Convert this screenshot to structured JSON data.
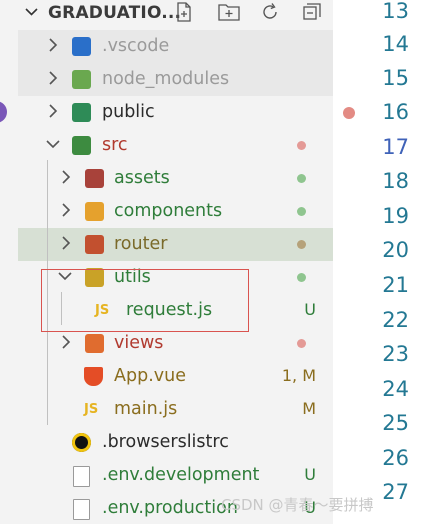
{
  "explorer": {
    "title": "GRADUATIO...",
    "actions": [
      "new-file-icon",
      "new-folder-icon",
      "refresh-icon",
      "collapse-all-icon"
    ],
    "items": [
      {
        "label": ".vscode",
        "kind": "folder",
        "expanded": false,
        "icon": "vscode-folder-icon",
        "color": "#9a9a9a",
        "depth": 0
      },
      {
        "label": "node_modules",
        "kind": "folder",
        "expanded": false,
        "icon": "node-folder-icon",
        "color": "#9a9a9a",
        "depth": 0
      },
      {
        "label": "public",
        "kind": "folder",
        "expanded": false,
        "icon": "public-folder-icon",
        "color": "#2b2b2b",
        "depth": 0
      },
      {
        "label": "src",
        "kind": "folder",
        "expanded": true,
        "icon": "src-folder-icon",
        "color": "#b13a2f",
        "status_dot": "#e49a96",
        "depth": 0
      },
      {
        "label": "assets",
        "kind": "folder",
        "expanded": false,
        "icon": "assets-folder-icon",
        "color": "#2f7d3a",
        "status_dot": "#8fc58f",
        "depth": 1
      },
      {
        "label": "components",
        "kind": "folder",
        "expanded": false,
        "icon": "components-folder-icon",
        "color": "#2f7d3a",
        "status_dot": "#8fc58f",
        "depth": 1
      },
      {
        "label": "router",
        "kind": "folder",
        "expanded": false,
        "icon": "router-folder-icon",
        "color": "#7a6a2a",
        "status_dot": "#b6a27a",
        "depth": 1,
        "selected": true
      },
      {
        "label": "utils",
        "kind": "folder",
        "expanded": true,
        "icon": "utils-folder-icon",
        "color": "#2f7d3a",
        "status_dot": "#8fc58f",
        "depth": 1
      },
      {
        "label": "request.js",
        "kind": "file",
        "icon": "js-file-icon",
        "color": "#2f7d3a",
        "badge": "U",
        "badge_color": "#2f7d3a",
        "depth": 2
      },
      {
        "label": "views",
        "kind": "folder",
        "expanded": false,
        "icon": "views-folder-icon",
        "color": "#b13a2f",
        "status_dot": "#e49a96",
        "depth": 1
      },
      {
        "label": "App.vue",
        "kind": "file",
        "icon": "html5-file-icon",
        "color": "#8a6d1e",
        "badge": "1, M",
        "badge_color": "#8a6d1e",
        "depth": 1
      },
      {
        "label": "main.js",
        "kind": "file",
        "icon": "js-file-icon",
        "color": "#8a6d1e",
        "badge": "M",
        "badge_color": "#8a6d1e",
        "depth": 1
      },
      {
        "label": ".browserslistrc",
        "kind": "file",
        "icon": "browserslist-file-icon",
        "color": "#2b2b2b",
        "depth": 0
      },
      {
        "label": ".env.development",
        "kind": "file",
        "icon": "env-file-icon",
        "color": "#2f7d3a",
        "badge": "U",
        "badge_color": "#2f7d3a",
        "depth": 0
      },
      {
        "label": ".env.production",
        "kind": "file",
        "icon": "env-file-icon",
        "color": "#2f7d3a",
        "badge": "U",
        "badge_color": "#2f7d3a",
        "depth": 0
      }
    ]
  },
  "editor": {
    "line_numbers": [
      "13",
      "14",
      "15",
      "16",
      "17",
      "18",
      "19",
      "20",
      "21",
      "22",
      "23",
      "24",
      "25",
      "26",
      "27"
    ],
    "current_line": "17",
    "breakpoint_line": "16"
  },
  "watermark": "CSDN @青春～要拼搏"
}
